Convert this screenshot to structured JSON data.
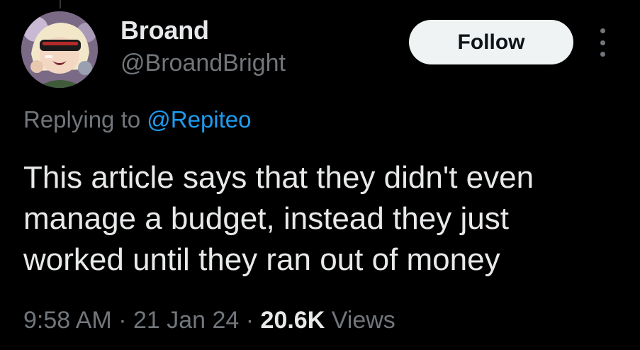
{
  "user": {
    "display_name": "Broand",
    "handle": "@BroandBright",
    "avatar": "cartoon-character-avatar"
  },
  "actions": {
    "follow_label": "Follow",
    "more_icon": "vertical-ellipsis-icon"
  },
  "reply": {
    "prefix": "Replying to ",
    "mention": "@Repiteo"
  },
  "tweet": {
    "lines": [
      "This article says that they didn't even",
      "manage a budget, instead they just",
      "worked until they ran out of money"
    ]
  },
  "meta": {
    "time": "9:58 AM",
    "sep1": " · ",
    "date": "21 Jan 24",
    "sep2": " · ",
    "views_count": "20.6K",
    "views_label": " Views"
  },
  "colors": {
    "background": "#000000",
    "primary_text": "#e7e9ea",
    "secondary_text": "#71767b",
    "link": "#1d9bf0",
    "button_bg": "#eff3f4"
  }
}
